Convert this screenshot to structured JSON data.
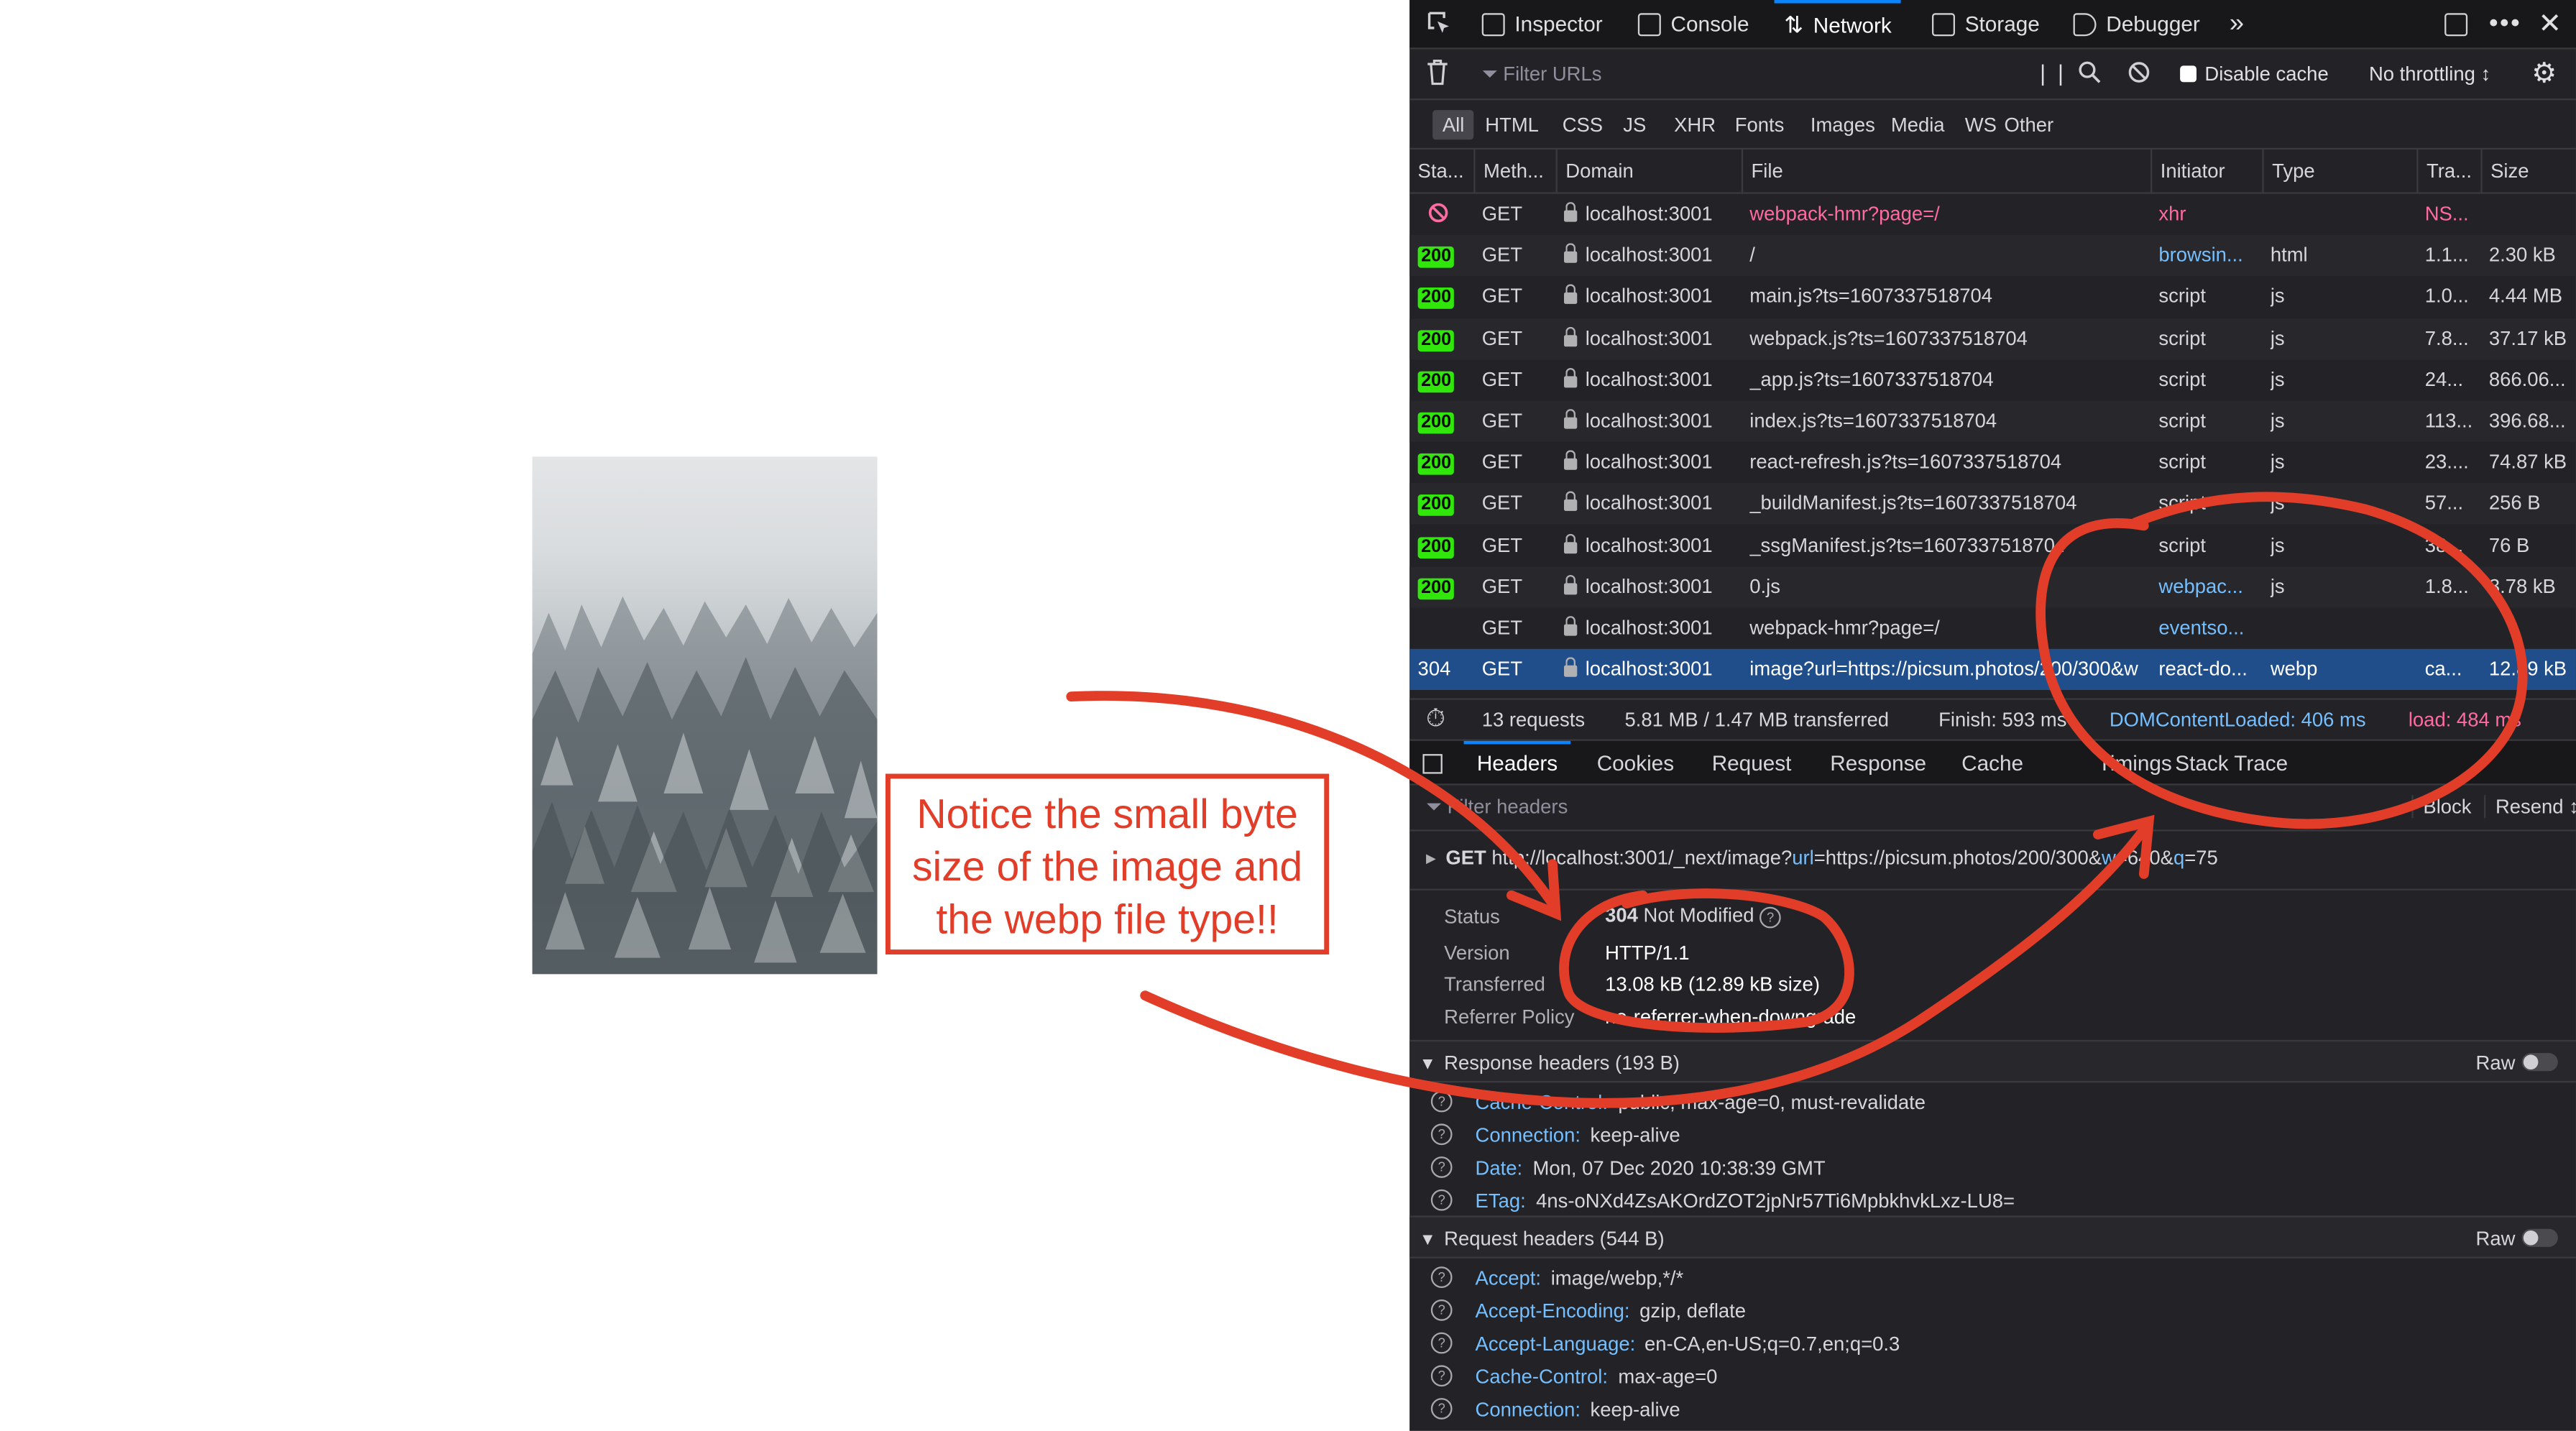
{
  "devtools": {
    "tabs": [
      "Inspector",
      "Console",
      "Network",
      "Storage",
      "Debugger"
    ],
    "active_tab": "Network",
    "filter_placeholder": "Filter URLs",
    "disable_cache_label": "Disable cache",
    "throttling_label": "No throttling ↕",
    "type_filters": [
      "All",
      "HTML",
      "CSS",
      "JS",
      "XHR",
      "Fonts",
      "Images",
      "Media",
      "WS",
      "Other"
    ],
    "columns": [
      "Sta...",
      "Meth...",
      "Domain",
      "File",
      "Initiator",
      "Type",
      "Tra...",
      "Size"
    ],
    "requests": [
      {
        "status": "",
        "blocked": true,
        "method": "GET",
        "domain": "localhost:3001",
        "file": "webpack-hmr?page=/",
        "initiator": "xhr",
        "type": "",
        "transferred": "NS...",
        "size": ""
      },
      {
        "status": "200",
        "method": "GET",
        "domain": "localhost:3001",
        "file": "/",
        "initiator": "browsin...",
        "type": "html",
        "transferred": "1.1...",
        "size": "2.30 kB"
      },
      {
        "status": "200",
        "method": "GET",
        "domain": "localhost:3001",
        "file": "main.js?ts=1607337518704",
        "initiator": "script",
        "type": "js",
        "transferred": "1.0...",
        "size": "4.44 MB"
      },
      {
        "status": "200",
        "method": "GET",
        "domain": "localhost:3001",
        "file": "webpack.js?ts=1607337518704",
        "initiator": "script",
        "type": "js",
        "transferred": "7.8...",
        "size": "37.17 kB"
      },
      {
        "status": "200",
        "method": "GET",
        "domain": "localhost:3001",
        "file": "_app.js?ts=1607337518704",
        "initiator": "script",
        "type": "js",
        "transferred": "24...",
        "size": "866.06..."
      },
      {
        "status": "200",
        "method": "GET",
        "domain": "localhost:3001",
        "file": "index.js?ts=1607337518704",
        "initiator": "script",
        "type": "js",
        "transferred": "113...",
        "size": "396.68..."
      },
      {
        "status": "200",
        "method": "GET",
        "domain": "localhost:3001",
        "file": "react-refresh.js?ts=1607337518704",
        "initiator": "script",
        "type": "js",
        "transferred": "23....",
        "size": "74.87 kB"
      },
      {
        "status": "200",
        "method": "GET",
        "domain": "localhost:3001",
        "file": "_buildManifest.js?ts=1607337518704",
        "initiator": "script",
        "type": "js",
        "transferred": "57...",
        "size": "256 B"
      },
      {
        "status": "200",
        "method": "GET",
        "domain": "localhost:3001",
        "file": "_ssgManifest.js?ts=1607337518704",
        "initiator": "script",
        "type": "js",
        "transferred": "38...",
        "size": "76 B"
      },
      {
        "status": "200",
        "method": "GET",
        "domain": "localhost:3001",
        "file": "0.js",
        "initiator": "webpac...",
        "type": "js",
        "transferred": "1.8...",
        "size": "3.78 kB"
      },
      {
        "status": "",
        "method": "GET",
        "domain": "localhost:3001",
        "file": "webpack-hmr?page=/",
        "initiator": "eventso...",
        "type": "",
        "transferred": "",
        "size": ""
      },
      {
        "status": "304",
        "method": "GET",
        "domain": "localhost:3001",
        "file": "image?url=https://picsum.photos/200/300&w",
        "initiator": "react-do...",
        "type": "webp",
        "transferred": "ca...",
        "size": "12.89 kB",
        "selected": true
      }
    ],
    "summary": {
      "requests": "13 requests",
      "transferred": "5.81 MB / 1.47 MB transferred",
      "finish": "Finish: 593 ms",
      "dom": "DOMContentLoaded: 406 ms",
      "load": "load: 484 ms"
    },
    "detail_tabs": [
      "Headers",
      "Cookies",
      "Request",
      "Response",
      "Cache",
      "Timings",
      "Stack Trace"
    ],
    "filter_headers_placeholder": "Filter headers",
    "block_label": "Block",
    "resend_label": "Resend ↕",
    "request_line": {
      "method": "GET",
      "url_a": "http://localhost:3001/_next/image?",
      "url_key1": "url",
      "url_b": "=https://picsum.photos/200/300&",
      "url_key2": "w",
      "url_c": "=640&",
      "url_key3": "q",
      "url_d": "=75"
    },
    "summary_fields": {
      "status_label": "Status",
      "status_code": "304",
      "status_text": "Not Modified",
      "version_label": "Version",
      "version": "HTTP/1.1",
      "transferred_label": "Transferred",
      "transferred": "13.08 kB (12.89 kB size)",
      "referrer_label": "Referrer Policy",
      "referrer": "no-referrer-when-downgrade"
    },
    "response_headers_title": "Response headers (193 B)",
    "raw_label": "Raw",
    "response_headers": [
      {
        "name": "Cache-Control:",
        "value": "public, max-age=0, must-revalidate"
      },
      {
        "name": "Connection:",
        "value": "keep-alive"
      },
      {
        "name": "Date:",
        "value": "Mon, 07 Dec 2020 10:38:39 GMT"
      },
      {
        "name": "ETag:",
        "value": "4ns-oNXd4ZsAKOrdZOT2jpNr57Ti6MpbkhvkLxz-LU8="
      }
    ],
    "request_headers_title": "Request headers (544 B)",
    "request_headers": [
      {
        "name": "Accept:",
        "value": "image/webp,*/*"
      },
      {
        "name": "Accept-Encoding:",
        "value": "gzip, deflate"
      },
      {
        "name": "Accept-Language:",
        "value": "en-CA,en-US;q=0.7,en;q=0.3"
      },
      {
        "name": "Cache-Control:",
        "value": "max-age=0"
      },
      {
        "name": "Connection:",
        "value": "keep-alive"
      }
    ]
  },
  "annotation": {
    "text": "Notice the small byte size of the image and the webp file type!!",
    "color": "#e23d28"
  },
  "colors": {
    "status_ok": "#30e60b",
    "selected_row": "#204e8a",
    "accent": "#0a84ff"
  }
}
